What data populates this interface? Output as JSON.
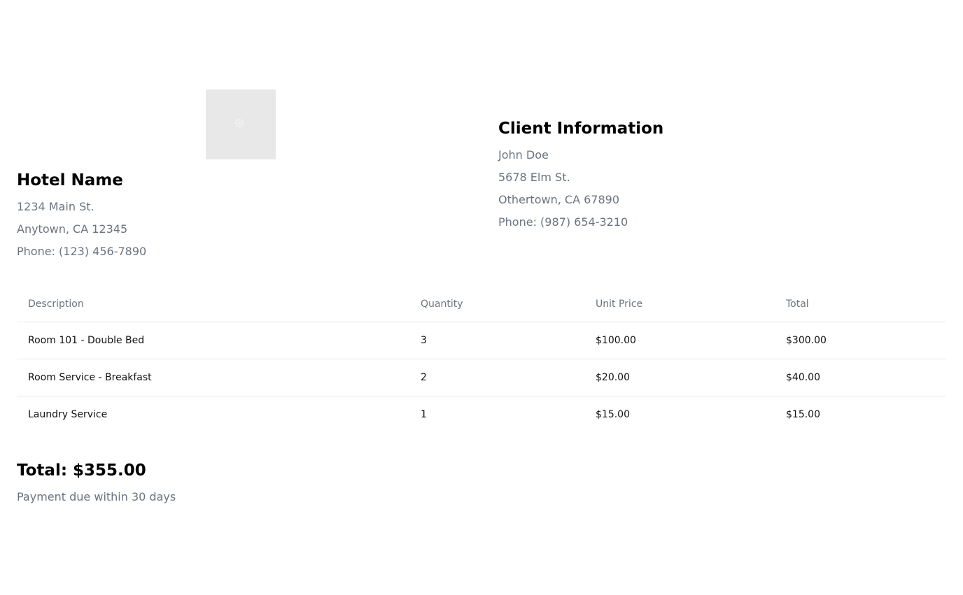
{
  "hotel": {
    "name": "Hotel Name",
    "address_line1": "1234 Main St.",
    "address_line2": "Anytown, CA 12345",
    "phone": "Phone: (123) 456-7890"
  },
  "client": {
    "heading": "Client Information",
    "name": "John Doe",
    "address_line1": "5678 Elm St.",
    "address_line2": "Othertown, CA 67890",
    "phone": "Phone: (987) 654-3210"
  },
  "table": {
    "headers": [
      "Description",
      "Quantity",
      "Unit Price",
      "Total"
    ],
    "rows": [
      [
        "Room 101 - Double Bed",
        "3",
        "$100.00",
        "$300.00"
      ],
      [
        "Room Service - Breakfast",
        "2",
        "$20.00",
        "$40.00"
      ],
      [
        "Laundry Service",
        "1",
        "$15.00",
        "$15.00"
      ]
    ]
  },
  "summary": {
    "total": "Total: $355.00",
    "payment_terms": "Payment due within 30 days"
  }
}
